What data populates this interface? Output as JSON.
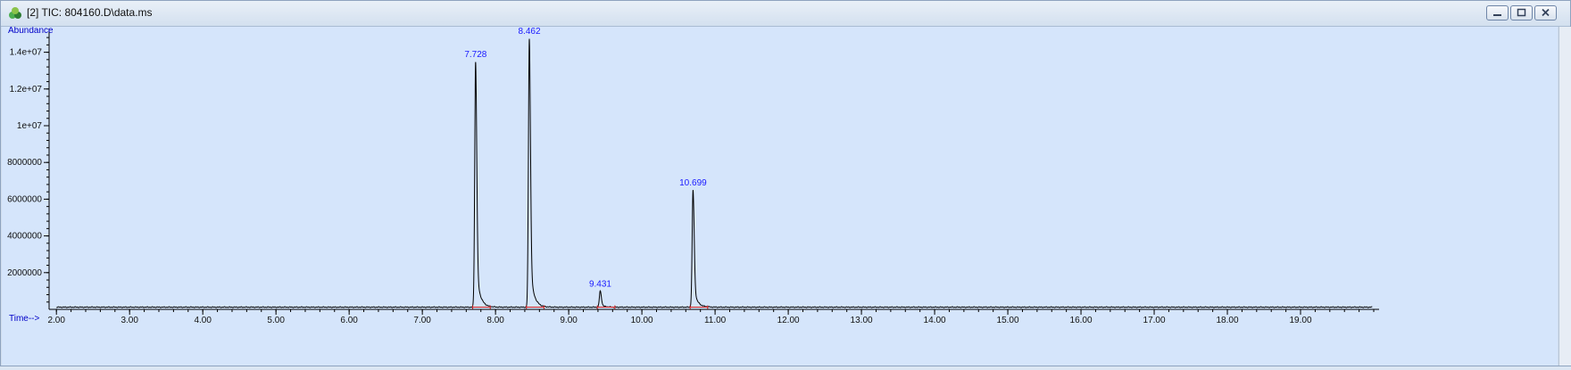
{
  "window": {
    "title": "[2] TIC: 804160.D\\data.ms",
    "icon": "chromatogram-app-icon",
    "buttons": {
      "minimize": "minimize-icon",
      "maximize": "maximize-icon",
      "close": "close-icon"
    }
  },
  "chart_data": {
    "type": "line",
    "ylabel": "Abundance",
    "xlabel": "Time-->",
    "xlim": [
      1.9,
      20.0
    ],
    "ylim": [
      0,
      15000000
    ],
    "xticks": [
      "2.00",
      "3.00",
      "4.00",
      "5.00",
      "6.00",
      "7.00",
      "8.00",
      "9.00",
      "10.00",
      "11.00",
      "12.00",
      "13.00",
      "14.00",
      "15.00",
      "16.00",
      "17.00",
      "18.00",
      "19.00"
    ],
    "yticks": [
      "2000000",
      "4000000",
      "6000000",
      "8000000",
      "1e+07",
      "1.2e+07",
      "1.4e+07"
    ],
    "ytick_values": [
      2000000,
      4000000,
      6000000,
      8000000,
      10000000,
      12000000,
      14000000
    ],
    "baseline": 120000,
    "peaks": [
      {
        "label": "7.728",
        "rt": 7.728,
        "height": 13500000
      },
      {
        "label": "8.462",
        "rt": 8.462,
        "height": 14750000
      },
      {
        "label": "9.431",
        "rt": 9.431,
        "height": 1000000
      },
      {
        "label": "10.699",
        "rt": 10.699,
        "height": 6500000
      }
    ],
    "colors": {
      "trace": "#000000",
      "axis_labels": "#0000c8",
      "peak_labels": "#1a1aff",
      "integration": "#d42020",
      "background": "#d5e5fb"
    }
  }
}
